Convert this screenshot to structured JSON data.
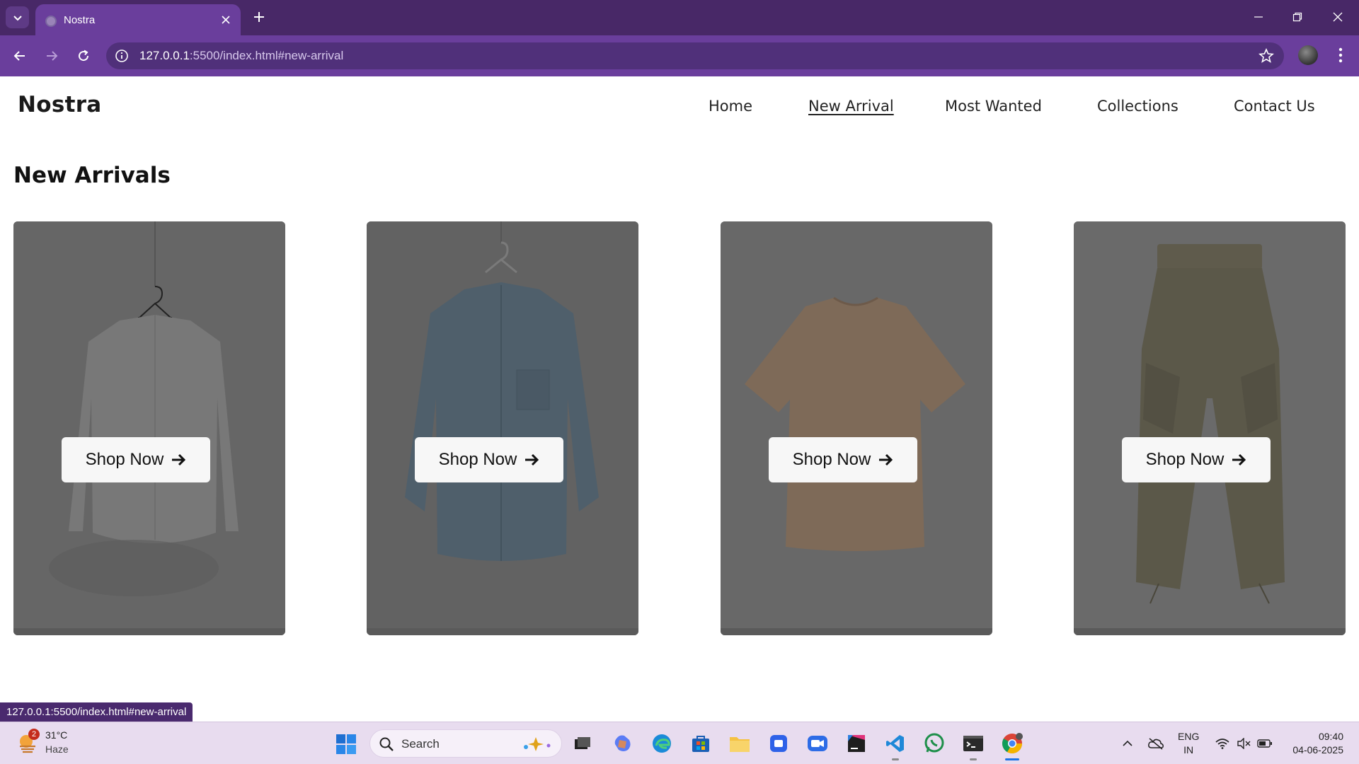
{
  "browser": {
    "tab_title": "Nostra",
    "url_host": "127.0.0.1",
    "url_rest": ":5500/index.html#new-arrival",
    "status_url": "127.0.0.1:5500/index.html#new-arrival"
  },
  "site": {
    "brand": "Nostra",
    "nav": [
      {
        "label": "Home",
        "active": false
      },
      {
        "label": "New Arrival",
        "active": true
      },
      {
        "label": "Most Wanted",
        "active": false
      },
      {
        "label": "Collections",
        "active": false
      },
      {
        "label": "Contact Us",
        "active": false
      }
    ],
    "section_title": "New Arrivals",
    "products": [
      {
        "garment": "white-shirt",
        "button_label": "Shop Now",
        "button_icon": "arrow-right-icon"
      },
      {
        "garment": "denim-shirt",
        "button_label": "Shop Now",
        "button_icon": "arrow-right-icon"
      },
      {
        "garment": "tan-tshirt",
        "button_label": "Shop Now",
        "button_icon": "arrow-right-icon"
      },
      {
        "garment": "cargo-pants",
        "button_label": "Shop Now",
        "button_icon": "arrow-right-icon"
      }
    ]
  },
  "taskbar": {
    "weather_badge": "2",
    "weather_temp": "31°C",
    "weather_desc": "Haze",
    "search_placeholder": "Search",
    "lang_line1": "ENG",
    "lang_line2": "IN",
    "time": "09:40",
    "date": "04-06-2025"
  },
  "colors": {
    "tabbar": "#482867",
    "toolbar": "#6a3e9c",
    "card_overlay": "#6c6c6c",
    "taskbar": "#e8dcef"
  }
}
